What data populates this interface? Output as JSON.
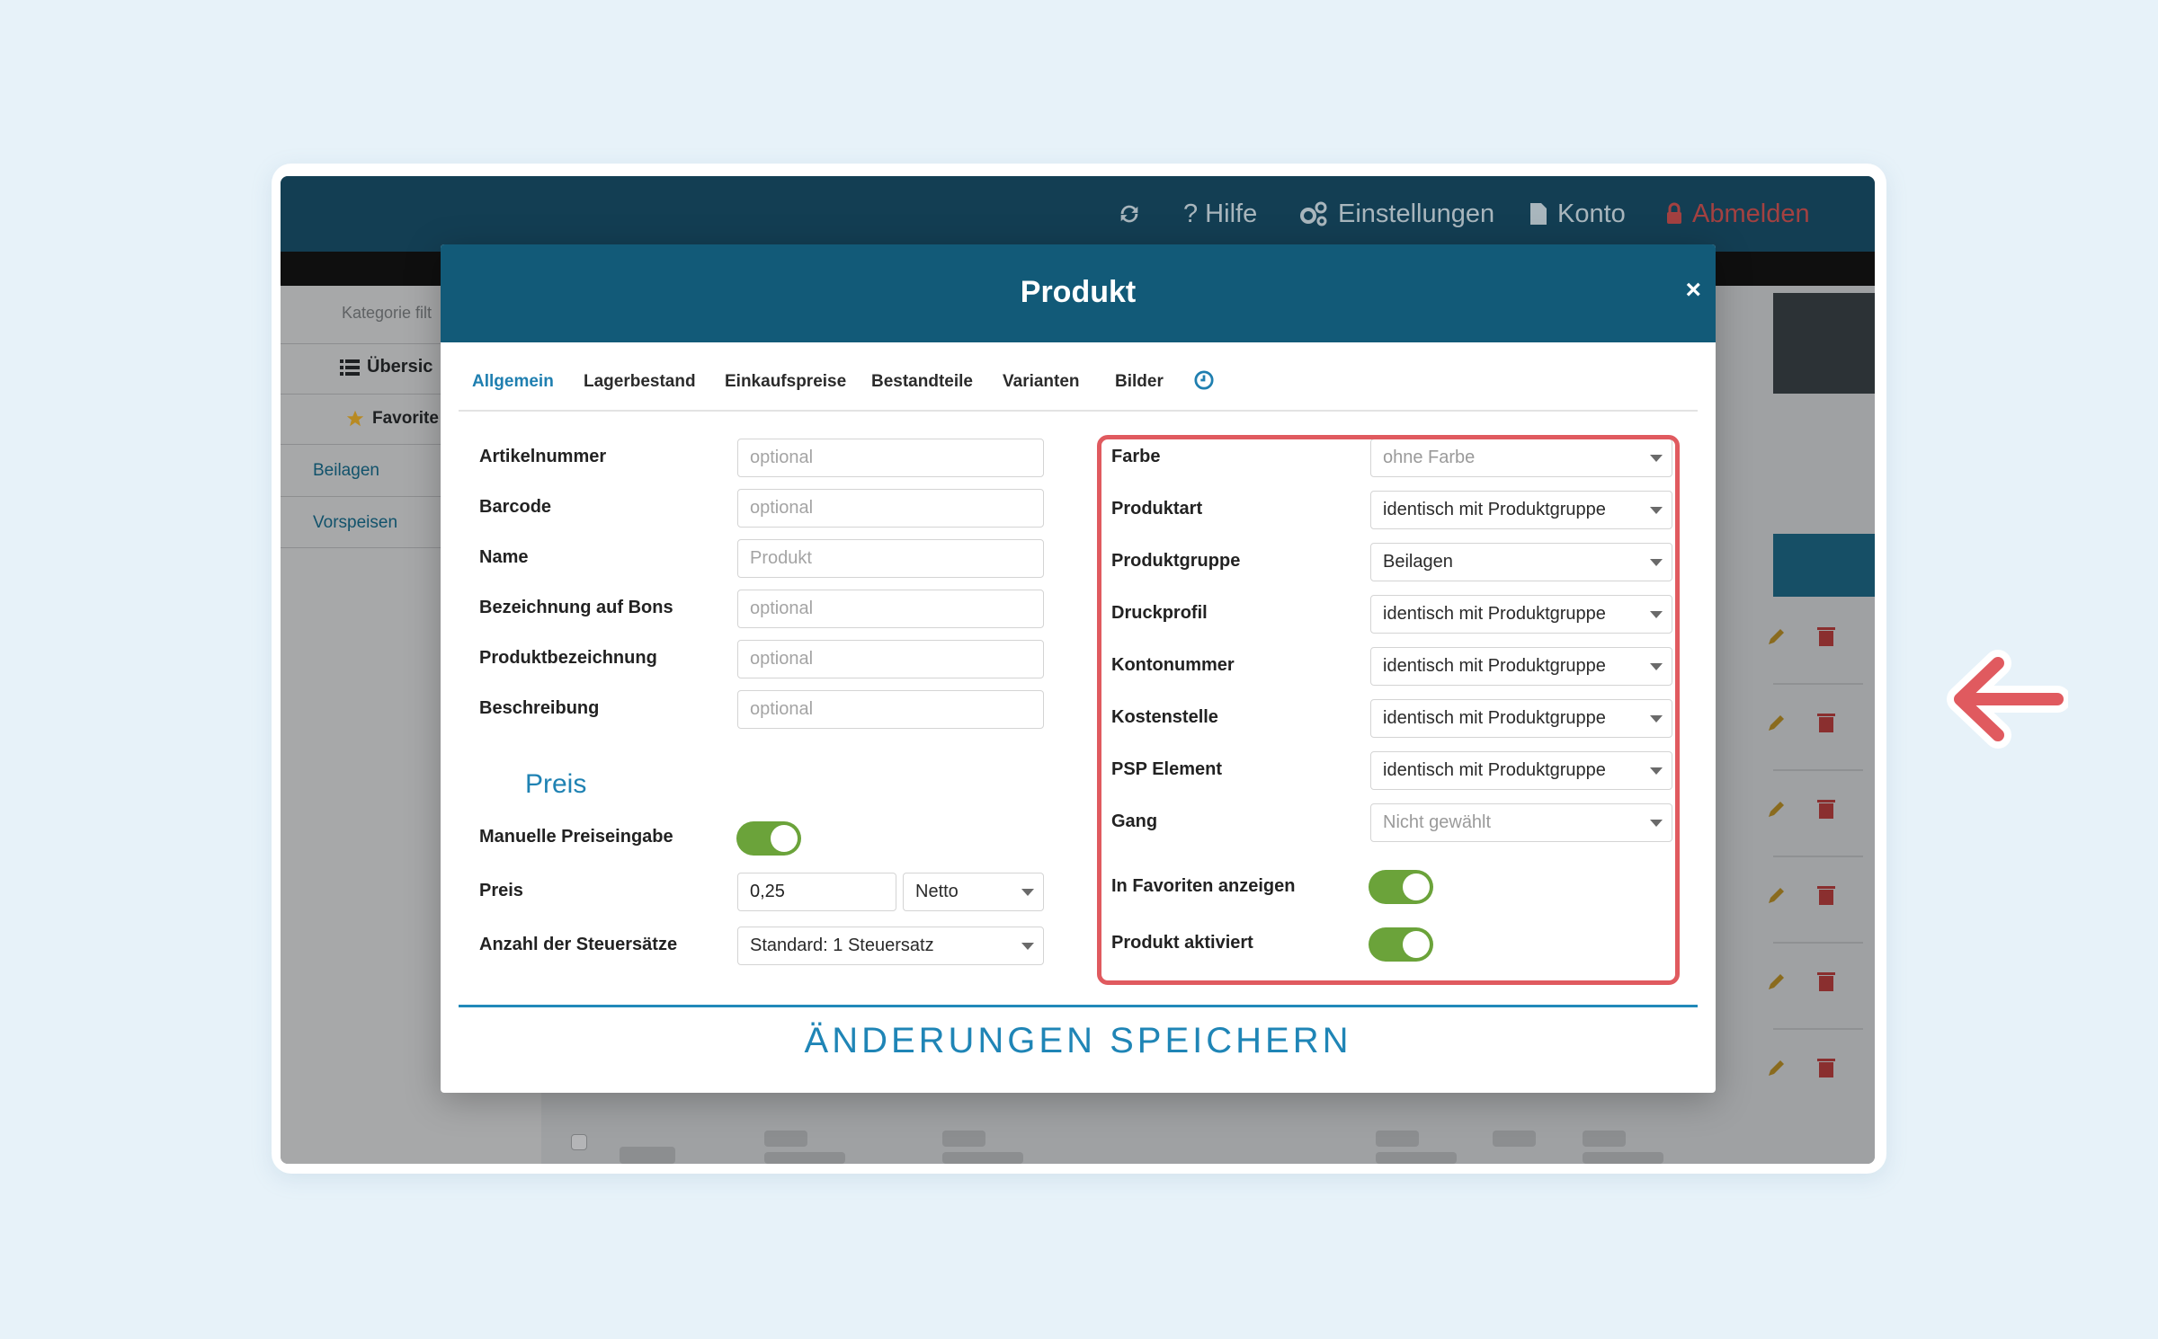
{
  "topnav": {
    "refresh_icon": "refresh-icon",
    "help": "? Hilfe",
    "settings": "Einstellungen",
    "account": "Konto",
    "logout": "Abmelden"
  },
  "sidebar": {
    "filter_placeholder": "Kategorie filt",
    "overview": "Übersic",
    "favorites": "Favorite",
    "links": [
      "Beilagen",
      "Vorspeisen"
    ]
  },
  "modal": {
    "title": "Produkt",
    "close": "×",
    "tabs": [
      "Allgemein",
      "Lagerbestand",
      "Einkaufspreise",
      "Bestandteile",
      "Varianten",
      "Bilder"
    ],
    "active_tab": "Allgemein",
    "left_fields": [
      {
        "label": "Artikelnummer",
        "placeholder": "optional"
      },
      {
        "label": "Barcode",
        "placeholder": "optional"
      },
      {
        "label": "Name",
        "placeholder": "Produkt"
      },
      {
        "label": "Bezeichnung auf Bons",
        "placeholder": "optional"
      },
      {
        "label": "Produktbezeichnung",
        "placeholder": "optional"
      },
      {
        "label": "Beschreibung",
        "placeholder": "optional"
      }
    ],
    "price_section": {
      "title": "Preis",
      "manual_label": "Manuelle Preiseingabe",
      "manual_on": true,
      "price_label": "Preis",
      "price_value": "0,25",
      "price_type": "Netto",
      "tax_label": "Anzahl der Steuersätze",
      "tax_value": "Standard: 1 Steuersatz"
    },
    "right_fields": [
      {
        "label": "Farbe",
        "value": "ohne Farbe"
      },
      {
        "label": "Produktart",
        "value": "identisch mit Produktgruppe"
      },
      {
        "label": "Produktgruppe",
        "value": "Beilagen"
      },
      {
        "label": "Druckprofil",
        "value": "identisch mit Produktgruppe"
      },
      {
        "label": "Kontonummer",
        "value": "identisch mit Produktgruppe"
      },
      {
        "label": "Kostenstelle",
        "value": "identisch mit Produktgruppe"
      },
      {
        "label": "PSP Element",
        "value": "identisch mit Produktgruppe"
      },
      {
        "label": "Gang",
        "value": "Nicht gewählt"
      }
    ],
    "favorites_label": "In Favoriten anzeigen",
    "favorites_on": true,
    "active_label": "Produkt aktiviert",
    "active_on": true,
    "save": "ÄNDERUNGEN SPEICHERN"
  },
  "colors": {
    "header": "#125a78",
    "accent": "#1f82b3",
    "toggle": "#6ba33a",
    "highlight": "#e05a5f",
    "logout": "#a34141"
  }
}
